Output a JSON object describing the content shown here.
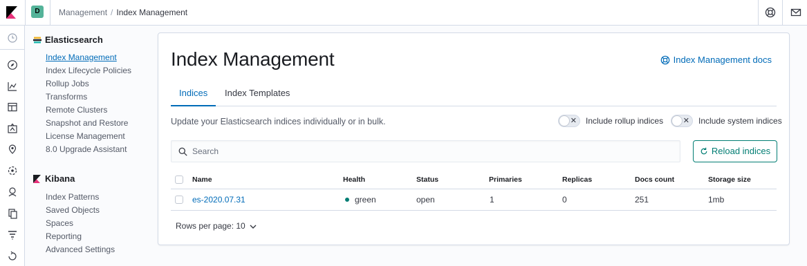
{
  "header": {
    "space_initial": "D",
    "breadcrumbs": [
      "Management",
      "Index Management"
    ],
    "breadcrumb_separator": "/"
  },
  "sidebar": {
    "sections": [
      {
        "title": "Elasticsearch",
        "items": [
          {
            "label": "Index Management",
            "active": true
          },
          {
            "label": "Index Lifecycle Policies"
          },
          {
            "label": "Rollup Jobs"
          },
          {
            "label": "Transforms"
          },
          {
            "label": "Remote Clusters"
          },
          {
            "label": "Snapshot and Restore"
          },
          {
            "label": "License Management"
          },
          {
            "label": "8.0 Upgrade Assistant"
          }
        ]
      },
      {
        "title": "Kibana",
        "items": [
          {
            "label": "Index Patterns"
          },
          {
            "label": "Saved Objects"
          },
          {
            "label": "Spaces"
          },
          {
            "label": "Reporting"
          },
          {
            "label": "Advanced Settings"
          }
        ]
      }
    ]
  },
  "main": {
    "title": "Index Management",
    "docs_link": "Index Management docs",
    "tabs": [
      {
        "label": "Indices",
        "active": true
      },
      {
        "label": "Index Templates"
      }
    ],
    "description": "Update your Elasticsearch indices individually or in bulk.",
    "toggles": {
      "rollup": {
        "label": "Include rollup indices",
        "on": false
      },
      "system": {
        "label": "Include system indices",
        "on": false
      }
    },
    "search_placeholder": "Search",
    "reload_label": "Reload indices",
    "table": {
      "columns": [
        "Name",
        "Health",
        "Status",
        "Primaries",
        "Replicas",
        "Docs count",
        "Storage size"
      ],
      "rows": [
        {
          "name": "es-2020.07.31",
          "health": "green",
          "status": "open",
          "primaries": "1",
          "replicas": "0",
          "docs_count": "251",
          "storage_size": "1mb"
        }
      ]
    },
    "rows_per_page": "Rows per page: 10"
  },
  "colors": {
    "accent": "#006bb8",
    "primary_button": "#017d73",
    "health_green": "#017d73"
  }
}
